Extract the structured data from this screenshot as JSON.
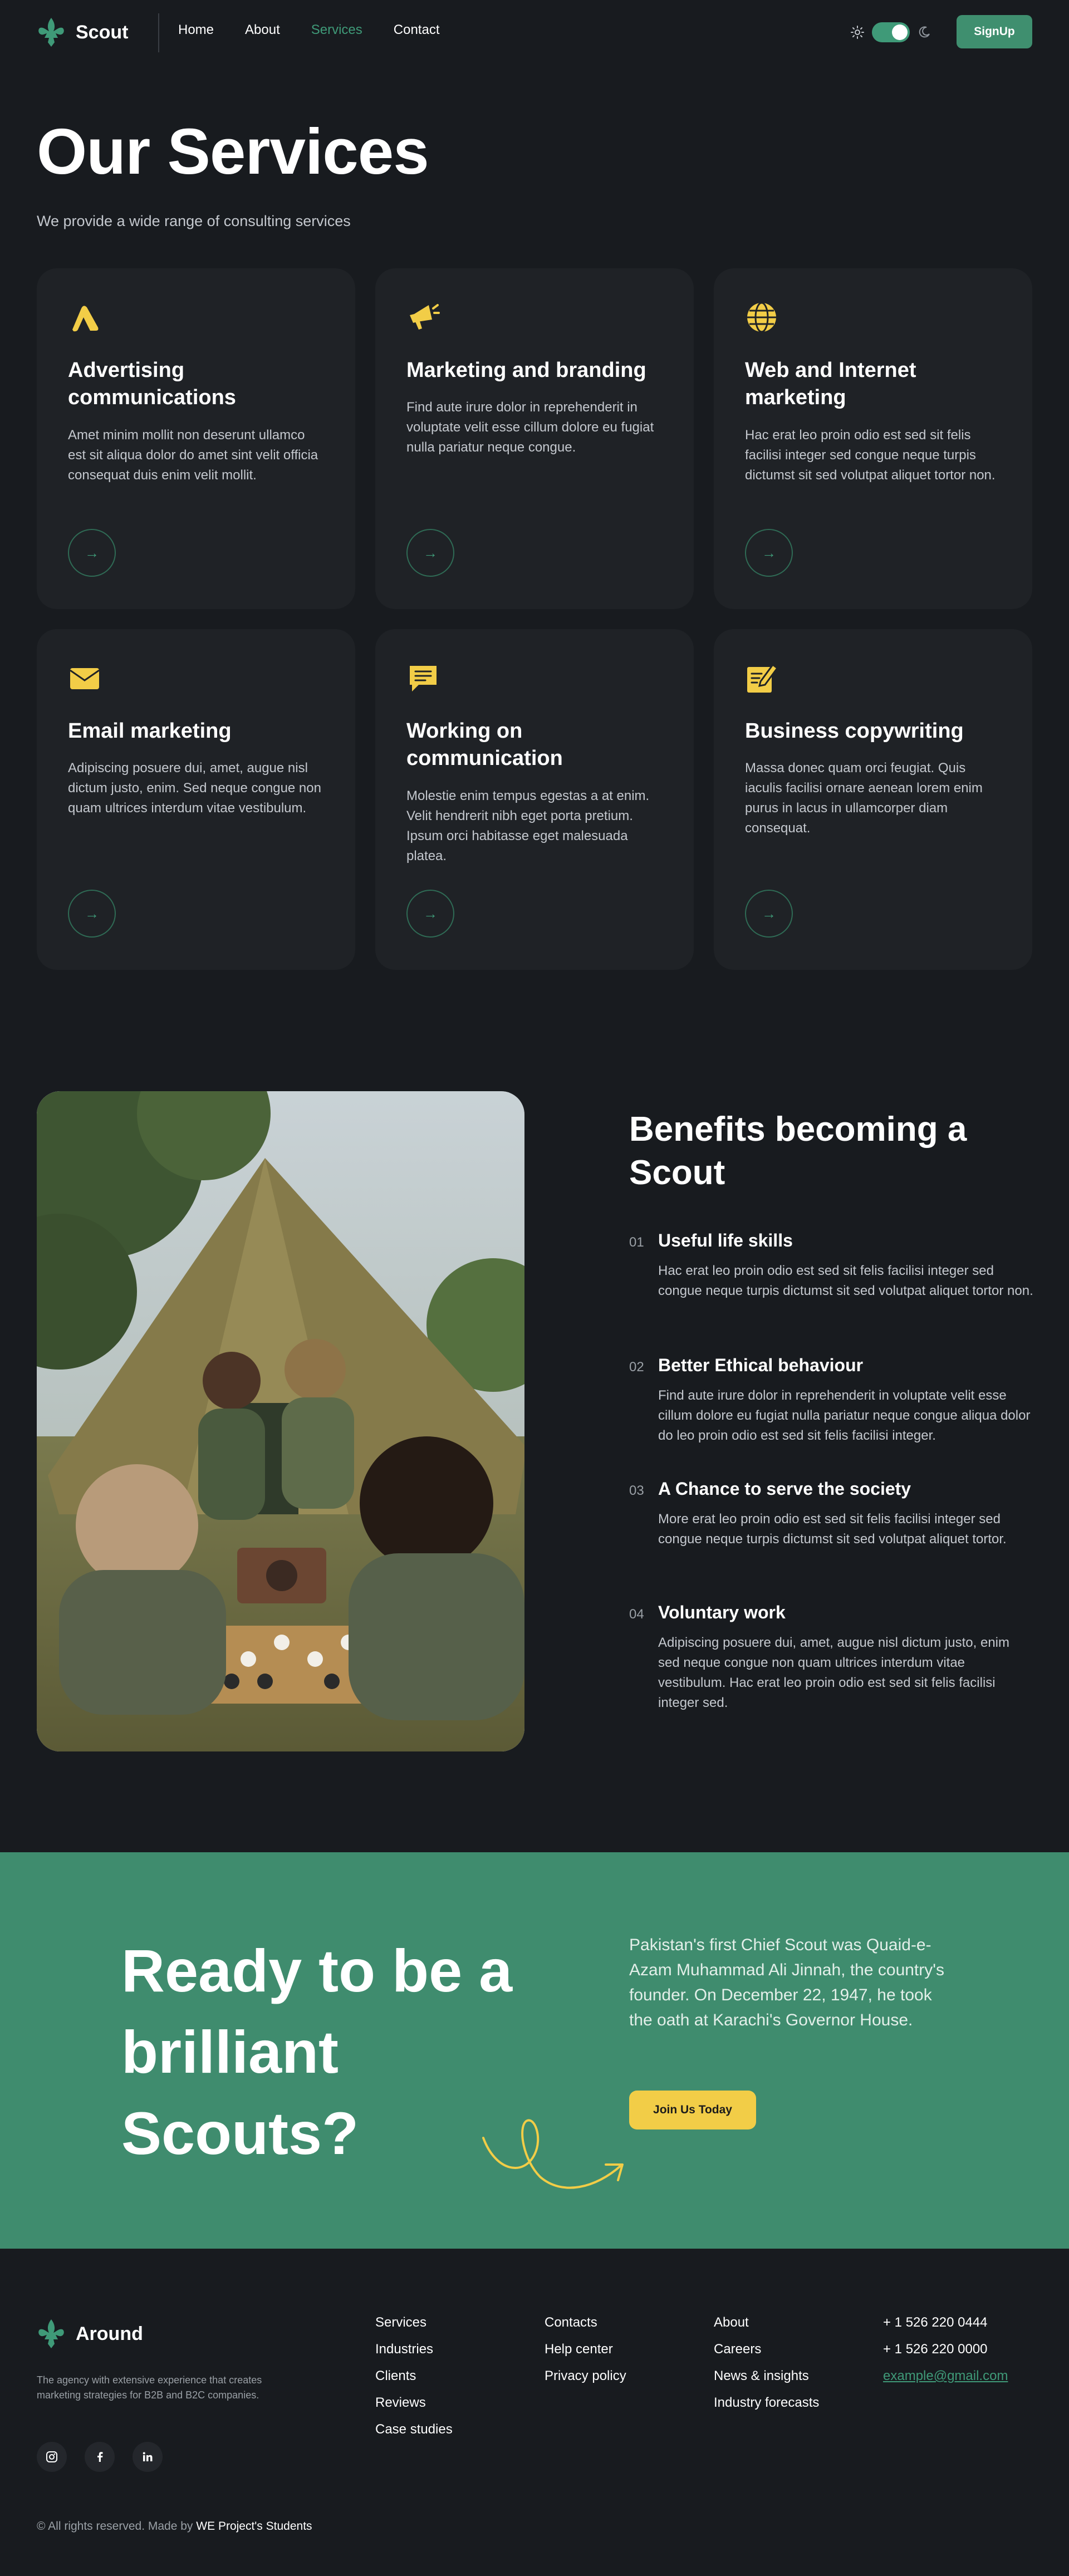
{
  "colors": {
    "accent": "#3f9a78",
    "yellow": "#f2cd47",
    "background": "#181b1f",
    "card": "#1f2226",
    "cta": "#3f8c6e"
  },
  "header": {
    "brand": "Scout",
    "logo_icon": "fleur-de-lis-icon",
    "nav": [
      "Home",
      "About",
      "Services",
      "Contact"
    ],
    "active_nav": "Services",
    "signup_label": "SignUp"
  },
  "services": {
    "title": "Our Services",
    "subtitle": "We provide a wide range of consulting services",
    "cards": [
      {
        "icon": "advertising-icon",
        "title": "Advertising communications",
        "text": "Amet minim mollit non deserunt ullamco est sit aliqua dolor do amet sint velit officia consequat duis enim velit mollit."
      },
      {
        "icon": "megaphone-icon",
        "title": "Marketing and branding",
        "text": "Find aute irure dolor in reprehenderit in voluptate velit esse cillum dolore eu fugiat nulla pariatur neque congue."
      },
      {
        "icon": "globe-icon",
        "title": "Web and Internet marketing",
        "text": "Hac erat leo proin odio est sed sit felis facilisi integer sed congue neque turpis dictumst sit sed volutpat aliquet tortor non."
      },
      {
        "icon": "envelope-icon",
        "title": "Email marketing",
        "text": "Adipiscing posuere dui, amet, augue nisl dictum justo, enim. Sed neque congue non quam ultrices interdum vitae vestibulum."
      },
      {
        "icon": "chat-icon",
        "title": "Working on communication",
        "text": "Molestie enim tempus egestas a at enim. Velit hendrerit nibh eget porta pretium. Ipsum orci habitasse eget malesuada platea."
      },
      {
        "icon": "edit-icon",
        "title": "Business copywriting",
        "text": "Massa donec quam orci feugiat. Quis iaculis facilisi ornare aenean lorem enim purus in lacus in ullamcorper diam consequat."
      }
    ]
  },
  "benefits": {
    "title": "Benefits becoming a Scout",
    "items": [
      {
        "num": "01",
        "title": "Useful life skills",
        "text": "Hac erat leo proin odio est sed sit felis facilisi integer sed congue neque turpis dictumst sit sed volutpat aliquet tortor non."
      },
      {
        "num": "02",
        "title": "Better Ethical behaviour",
        "text": "Find aute irure dolor in reprehenderit in voluptate velit esse cillum dolore eu fugiat nulla pariatur neque congue aliqua dolor do leo proin odio est sed sit felis facilisi integer."
      },
      {
        "num": "03",
        "title": "A Chance to serve the society",
        "text": "More erat leo proin odio est sed sit felis facilisi integer sed congue neque turpis dictumst sit sed volutpat aliquet tortor."
      },
      {
        "num": "04",
        "title": "Voluntary work",
        "text": "Adipiscing posuere dui, amet, augue nisl dictum justo, enim sed neque congue non quam ultrices interdum vitae vestibulum. Hac erat leo proin odio est sed sit felis facilisi integer sed."
      }
    ]
  },
  "cta": {
    "title": "Ready to be a brilliant Scouts?",
    "text": "Pakistan's first Chief Scout was Quaid-e-Azam Muhammad Ali Jinnah, the country's founder. On December 22, 1947, he took the oath at Karachi's Governor House.",
    "button": "Join Us Today"
  },
  "footer": {
    "brand": "Around",
    "description": "The agency with extensive experience that creates marketing strategies for B2B and B2C companies.",
    "socials": [
      "instagram-icon",
      "facebook-icon",
      "linkedin-icon"
    ],
    "col1": [
      "Services",
      "Industries",
      "Clients",
      "Reviews",
      "Case studies"
    ],
    "col2": [
      "Contacts",
      "Help center",
      "Privacy policy"
    ],
    "col3": [
      "About",
      "Careers",
      "News & insights",
      "Industry forecasts"
    ],
    "phone1": "+ 1 526 220 0444",
    "phone2": "+ 1 526 220 0000",
    "email": "example@gmail.com",
    "copyright_prefix": "© All rights reserved. Made by",
    "copyright_author": "WE Project's Students"
  }
}
